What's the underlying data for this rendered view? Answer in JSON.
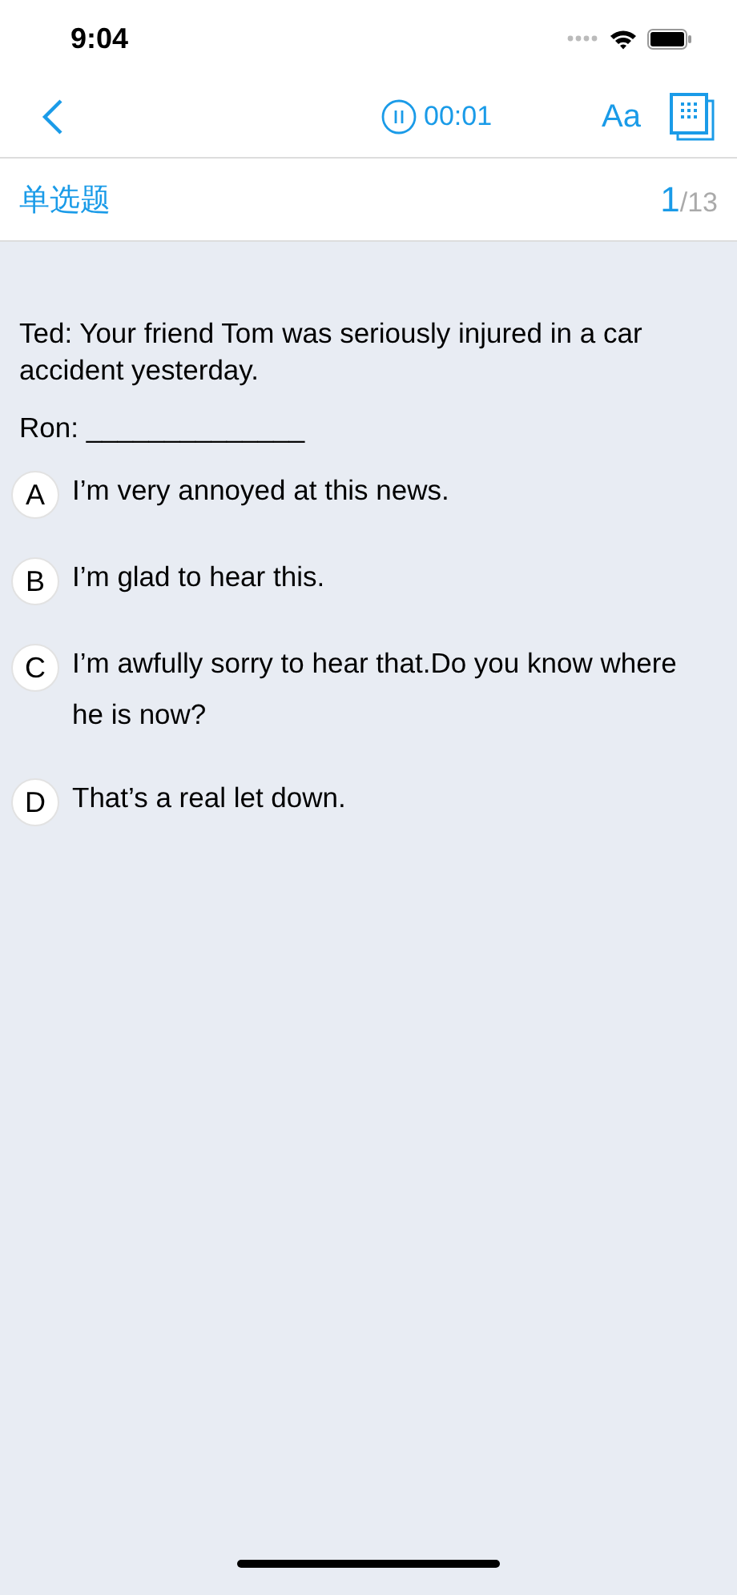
{
  "status_bar": {
    "time": "9:04"
  },
  "nav_bar": {
    "timer": "00:01",
    "font_button": "Aa"
  },
  "header": {
    "question_type": "单选题",
    "current": "1",
    "total": "/13"
  },
  "question": {
    "prompt": "Ted: Your friend Tom was seriously injured in a car accident yesterday.",
    "answer_line": "Ron: ______________"
  },
  "options": [
    {
      "letter": "A",
      "text": "I’m very annoyed at this news.",
      "selected": false
    },
    {
      "letter": "B",
      "text": "I’m glad to hear this.",
      "selected": false
    },
    {
      "letter": "C",
      "text": "I’m awfully sorry to hear that.Do you know where he is now?",
      "selected": false
    },
    {
      "letter": "D",
      "text": "That’s a real let down.",
      "selected": false
    }
  ]
}
